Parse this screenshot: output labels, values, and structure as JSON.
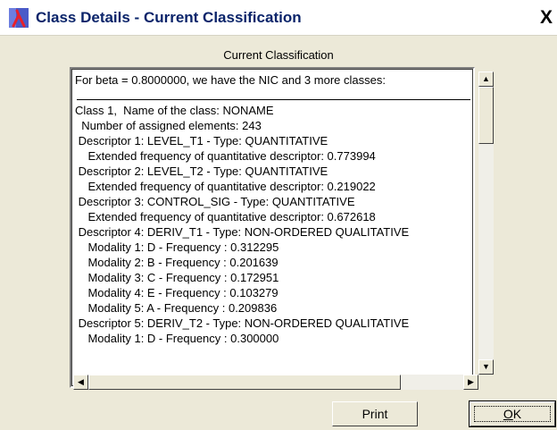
{
  "window": {
    "title": "Class Details - Current Classification",
    "close_label": "X",
    "app_icon": "lambda-app-icon"
  },
  "section_label": "Current Classification",
  "details": {
    "header": "For beta = 0.8000000, we have the NIC and 3 more classes:",
    "lines": [
      "Class 1,  Name of the class: NONAME",
      "  Number of assigned elements: 243",
      " Descriptor 1: LEVEL_T1 - Type: QUANTITATIVE",
      "    Extended frequency of quantitative descriptor: 0.773994",
      " Descriptor 2: LEVEL_T2 - Type: QUANTITATIVE",
      "    Extended frequency of quantitative descriptor: 0.219022",
      " Descriptor 3: CONTROL_SIG - Type: QUANTITATIVE",
      "    Extended frequency of quantitative descriptor: 0.672618",
      " Descriptor 4: DERIV_T1 - Type: NON-ORDERED QUALITATIVE",
      "    Modality 1: D - Frequency : 0.312295",
      "    Modality 2: B - Frequency : 0.201639",
      "    Modality 3: C - Frequency : 0.172951",
      "    Modality 4: E - Frequency : 0.103279",
      "    Modality 5: A - Frequency : 0.209836",
      " Descriptor 5: DERIV_T2 - Type: NON-ORDERED QUALITATIVE",
      "    Modality 1: D - Frequency : 0.300000"
    ]
  },
  "buttons": {
    "print": "Print",
    "ok_accel": "O",
    "ok_rest": "K"
  },
  "scrollbars": {
    "up": "▲",
    "down": "▼",
    "left": "◀",
    "right": "▶"
  }
}
